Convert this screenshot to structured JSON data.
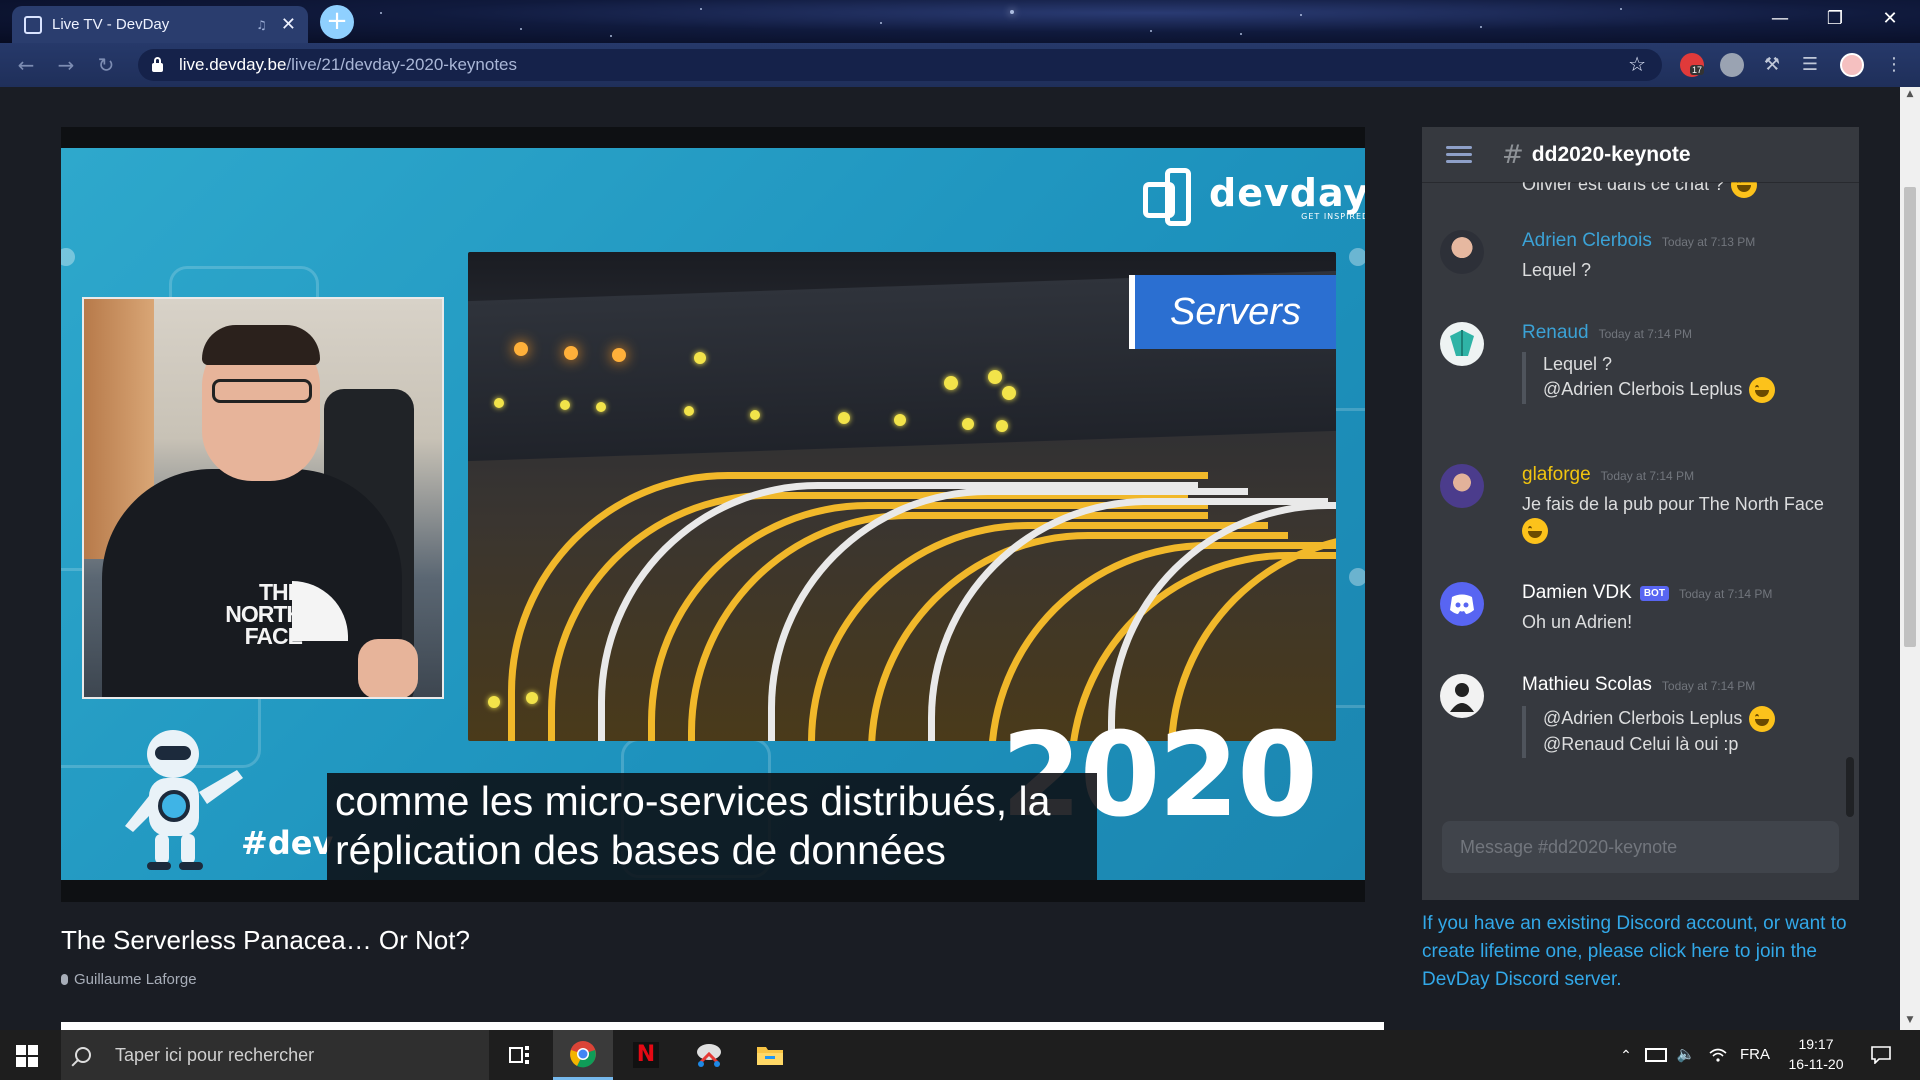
{
  "browser": {
    "tab_title": "Live TV - DevDay",
    "url_host": "live.devday.be",
    "url_path": "/live/21/devday-2020-keynotes"
  },
  "video": {
    "logo_word": "devday",
    "logo_tagline": "GET INSPIRED",
    "slide_label": "Servers",
    "year": "2020",
    "hashtag": "#dev",
    "subtitle_line1": "comme les micro-services distribués, la",
    "subtitle_line2": "réplication des bases de données",
    "shirt_text": "THE NORTH FACE"
  },
  "talk": {
    "title": "The Serverless Panacea… Or Not?",
    "speaker": "Guillaume Laforge"
  },
  "discord": {
    "channel": "dd2020-keynote",
    "partial_top_text": "Olivier est dans ce chat ?",
    "messages": [
      {
        "author": "Adrien Clerbois",
        "time": "Today at 7:13 PM",
        "lines": [
          "Lequel ?"
        ],
        "color": "#3ba2d6"
      },
      {
        "author": "Renaud",
        "time": "Today at 7:14 PM",
        "quote": [
          "Lequel ?",
          "@Adrien Clerbois Leplus"
        ],
        "color": "#3ba2d6"
      },
      {
        "author": "glaforge",
        "time": "Today at 7:14 PM",
        "lines": [
          "Je fais de la pub pour The North Face"
        ],
        "color": "#f1c40f"
      },
      {
        "author": "Damien VDK",
        "badge": "BOT",
        "time": "Today at 7:14 PM",
        "lines": [
          "Oh un Adrien!"
        ],
        "color": "#ffffff"
      },
      {
        "author": "Mathieu Scolas",
        "time": "Today at 7:14 PM",
        "quote": [
          "@Adrien Clerbois Leplus",
          "@Renaud Celui là oui :p"
        ],
        "color": "#ffffff"
      }
    ],
    "input_placeholder": "Message #dd2020-keynote",
    "join_text": "If you have an existing Discord account, or want to create lifetime one, please click here to join the DevDay Discord server."
  },
  "taskbar": {
    "search_placeholder": "Taper ici pour rechercher",
    "language": "FRA",
    "time": "19:17",
    "date": "16-11-20",
    "extension_badge": "17"
  }
}
